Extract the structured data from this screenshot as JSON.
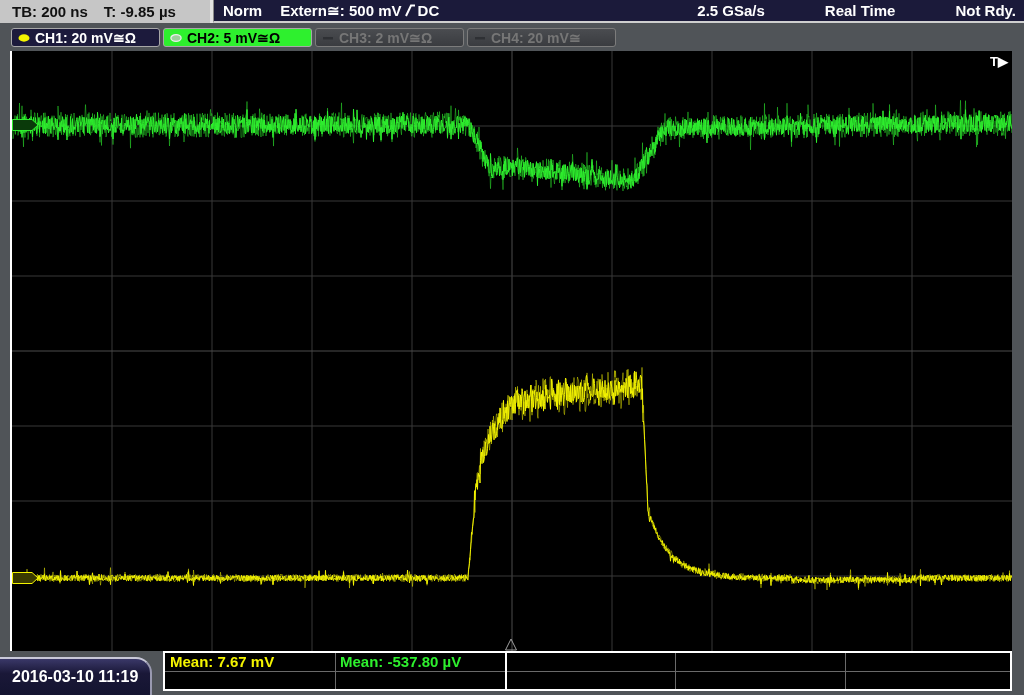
{
  "status_bar": {
    "timebase": "TB: 200 ns",
    "trigger_time": "T: -9.85 µs",
    "trigger_mode": "Norm",
    "trigger_source": "Extern≅: 500 mV",
    "coupling": "DC",
    "sample_rate": "2.5 GSa/s",
    "acquisition": "Real Time",
    "state": "Not Rdy."
  },
  "channels": [
    {
      "label": "CH1: 20 mV≅Ω",
      "color": "#f4f400",
      "on": true,
      "selected": false,
      "measurement": "Mean: 7.67 mV"
    },
    {
      "label": "CH2: 5 mV≅Ω",
      "color": "#2ef02e",
      "on": true,
      "selected": true,
      "measurement": "Mean: -537.80 µV"
    },
    {
      "label": "CH3: 2 mV≅Ω",
      "on": false,
      "selected": false
    },
    {
      "label": "CH4: 20 mV≅",
      "on": false,
      "selected": false
    }
  ],
  "display": {
    "trigger_marker": "T▶"
  },
  "timestamp": "2016-03-10 11:19"
}
